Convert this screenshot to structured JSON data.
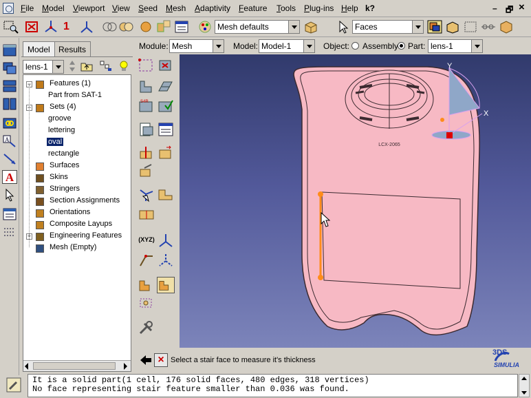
{
  "menubar": {
    "items": [
      {
        "label": "File",
        "u": "F",
        "rest": "ile"
      },
      {
        "label": "Model",
        "u": "M",
        "rest": "odel"
      },
      {
        "label": "Viewport",
        "u": "V",
        "rest": "iewport"
      },
      {
        "label": "View",
        "u": "V",
        "rest": "iew"
      },
      {
        "label": "Seed",
        "u": "S",
        "rest": "eed"
      },
      {
        "label": "Mesh",
        "u": "M",
        "rest": "esh"
      },
      {
        "label": "Adaptivity",
        "u": "A",
        "rest": "daptivity"
      },
      {
        "label": "Feature",
        "u": "F",
        "rest": "eature"
      },
      {
        "label": "Tools",
        "u": "T",
        "rest": "ools"
      },
      {
        "label": "Plug-ins",
        "u": "P",
        "rest": "lug-ins"
      },
      {
        "label": "Help",
        "u": "H",
        "rest": "elp"
      }
    ],
    "whats_this": "k?",
    "minimize": "–",
    "restore": "🗗",
    "close": "×"
  },
  "toolbar": {
    "mesh_defaults": "Mesh defaults",
    "selection_filter": "Faces",
    "view_number": "1"
  },
  "module_bar": {
    "module_label": "Module:",
    "module_value": "Mesh",
    "model_label": "Model:",
    "model_value": "Model-1",
    "object_label": "Object:",
    "assembly_label": "Assembly",
    "part_label": "Part:",
    "part_value": "lens-1"
  },
  "tree_panel": {
    "tabs": [
      "Model",
      "Results"
    ],
    "part_select": "lens-1",
    "items": [
      {
        "label": "Features (1)",
        "level": 0,
        "expander": "−"
      },
      {
        "label": "Part from SAT-1",
        "level": 1
      },
      {
        "label": "Sets (4)",
        "level": 0,
        "expander": "−"
      },
      {
        "label": "groove",
        "level": 1
      },
      {
        "label": "lettering",
        "level": 1
      },
      {
        "label": "oval",
        "level": 1,
        "selected": true
      },
      {
        "label": "rectangle",
        "level": 1
      },
      {
        "label": "Surfaces",
        "level": 0
      },
      {
        "label": "Skins",
        "level": 0
      },
      {
        "label": "Stringers",
        "level": 0
      },
      {
        "label": "Section Assignments",
        "level": 0
      },
      {
        "label": "Orientations",
        "level": 0
      },
      {
        "label": "Composite Layups",
        "level": 0
      },
      {
        "label": "Engineering Features",
        "level": 0,
        "expander": "+"
      },
      {
        "label": "Mesh (Empty)",
        "level": 0
      }
    ]
  },
  "viewport": {
    "lettering": "LCX-2065",
    "triad": {
      "y": "Y",
      "x": "X"
    }
  },
  "prompt": {
    "text": "Select a stair face to measure it's thickness"
  },
  "brand": {
    "logo_top": "3DS",
    "logo_bottom": "SIMULIA"
  },
  "messages": [
    "It is a solid part(1 cell, 176 solid faces, 480 edges, 318 vertices)",
    "No face representing stair feature smaller than 0.036 was found."
  ],
  "colors": {
    "part_fill": "#f7b9c4",
    "part_edge": "#3b2a30",
    "highlight": "#ff8c1a",
    "viewport_top": "#313a6c",
    "viewport_bottom": "#7c84ba",
    "selection": "#0a246a"
  }
}
